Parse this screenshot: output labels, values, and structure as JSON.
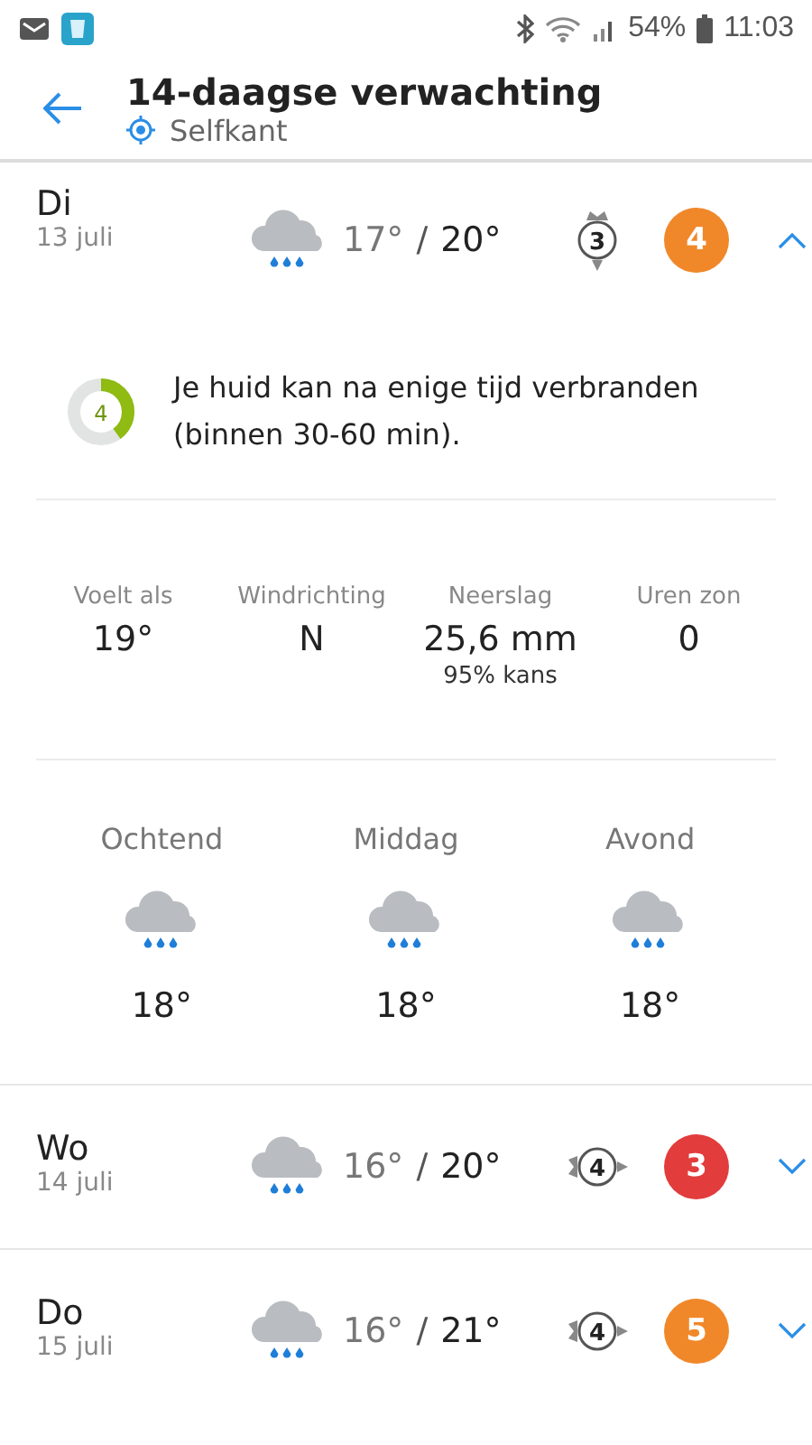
{
  "status_bar": {
    "battery": "54%",
    "time": "11:03"
  },
  "header": {
    "title": "14-daagse verwachting",
    "location": "Selfkant"
  },
  "days": [
    {
      "day": "Di",
      "date": "13 juli",
      "temp_min": "17°",
      "separator": "/",
      "temp_max": "20°",
      "wind": {
        "kind": "north",
        "force": "3"
      },
      "uv": "4",
      "color": "#f0882a",
      "expanded": true,
      "uv_summary": {
        "index": "4",
        "text": "Je huid kan na enige tijd verbranden (binnen 30-60 min)."
      },
      "details": [
        {
          "label": "Voelt als",
          "value": "19°"
        },
        {
          "label": "Windrichting",
          "value": "N"
        },
        {
          "label": "Neerslag",
          "value": "25,6 mm",
          "note": "95% kans"
        },
        {
          "label": "Uren zon",
          "value": "0"
        }
      ],
      "parts": [
        {
          "label": "Ochtend",
          "temp": "18°"
        },
        {
          "label": "Middag",
          "temp": "18°"
        },
        {
          "label": "Avond",
          "temp": "18°"
        }
      ]
    },
    {
      "day": "Wo",
      "date": "14 juli",
      "temp_min": "16°",
      "separator": "/",
      "temp_max": "20°",
      "wind": {
        "kind": "west",
        "force": "4"
      },
      "uv": "3",
      "color": "#e23c3c",
      "expanded": false
    },
    {
      "day": "Do",
      "date": "15 juli",
      "temp_min": "16°",
      "separator": "/",
      "temp_max": "21°",
      "wind": {
        "kind": "west",
        "force": "4"
      },
      "uv": "5",
      "color": "#f0882a",
      "expanded": false
    }
  ]
}
